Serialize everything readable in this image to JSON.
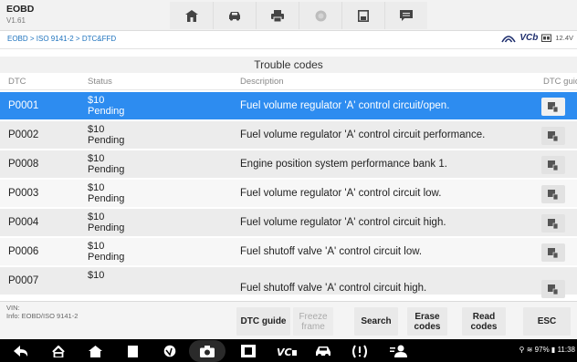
{
  "app": {
    "title": "EOBD",
    "version": "V1.61"
  },
  "toolbar": {
    "icons": [
      "home-icon",
      "vehicle-icon",
      "print-icon",
      "help-icon",
      "save-icon",
      "message-icon"
    ]
  },
  "breadcrumb": "EOBD > ISO 9141-2 > DTC&FFD",
  "status": {
    "vci_label": "VCb",
    "voltage": "12.4V"
  },
  "section_title": "Trouble codes",
  "columns": {
    "dtc": "DTC",
    "status": "Status",
    "description": "Description",
    "guide": "DTC guide"
  },
  "rows": [
    {
      "code": "P0001",
      "status_line1": "$10",
      "status_line2": "Pending",
      "description": "Fuel volume regulator 'A' control circuit/open.",
      "selected": true
    },
    {
      "code": "P0002",
      "status_line1": "$10",
      "status_line2": "Pending",
      "description": "Fuel volume regulator 'A' control circuit performance."
    },
    {
      "code": "P0008",
      "status_line1": "$10",
      "status_line2": "Pending",
      "description": "Engine position system performance bank 1."
    },
    {
      "code": "P0003",
      "status_line1": "$10",
      "status_line2": "Pending",
      "description": "Fuel volume regulator 'A' control circuit low."
    },
    {
      "code": "P0004",
      "status_line1": "$10",
      "status_line2": "Pending",
      "description": "Fuel volume regulator 'A' control circuit high."
    },
    {
      "code": "P0006",
      "status_line1": "$10",
      "status_line2": "Pending",
      "description": "Fuel shutoff valve 'A' control circuit low."
    },
    {
      "code": "P0007",
      "status_line1": "$10",
      "status_line2": "",
      "description": "Fuel shutoff valve 'A' control circuit high."
    }
  ],
  "footer": {
    "vin_label": "VIN:",
    "info": "Info: EOBD/ISO 9141-2",
    "buttons": {
      "dtc_guide": "DTC guide",
      "freeze_frame_1": "Freeze",
      "freeze_frame_2": "frame",
      "search": "Search",
      "erase_1": "Erase",
      "erase_2": "codes",
      "read_1": "Read",
      "read_2": "codes",
      "esc": "ESC"
    }
  },
  "system": {
    "battery": "97%",
    "time": "11:38"
  },
  "colors": {
    "selected": "#2d8cf0",
    "link": "#1e73be",
    "navbar": "#000000"
  }
}
